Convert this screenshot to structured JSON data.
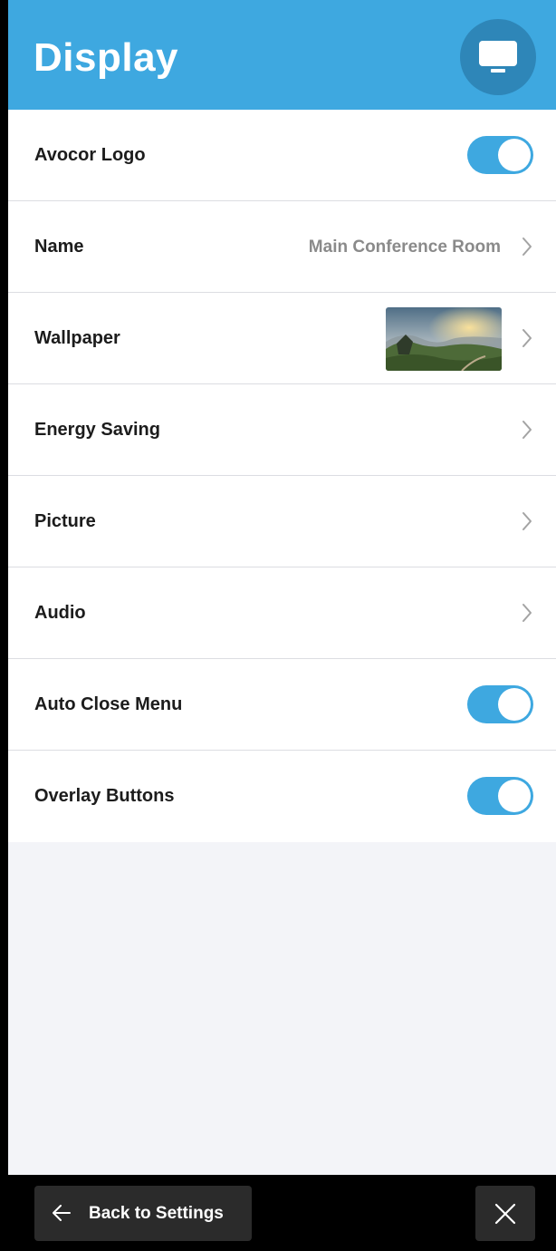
{
  "header": {
    "title": "Display",
    "icon": "monitor-icon"
  },
  "colors": {
    "accent": "#3ea8e0",
    "header_icon_bg": "#2e86b8",
    "background": "#f3f4f8"
  },
  "rows": [
    {
      "label": "Avocor Logo",
      "type": "toggle",
      "on": true
    },
    {
      "label": "Name",
      "type": "link",
      "value": "Main Conference Room"
    },
    {
      "label": "Wallpaper",
      "type": "link",
      "thumbnail": "landscape-wallpaper"
    },
    {
      "label": "Energy Saving",
      "type": "link"
    },
    {
      "label": "Picture",
      "type": "link"
    },
    {
      "label": "Audio",
      "type": "link"
    },
    {
      "label": "Auto Close Menu",
      "type": "toggle",
      "on": true
    },
    {
      "label": "Overlay Buttons",
      "type": "toggle",
      "on": true
    }
  ],
  "footer": {
    "back_label": "Back to Settings",
    "back_icon": "arrow-left-icon",
    "close_icon": "close-icon"
  }
}
